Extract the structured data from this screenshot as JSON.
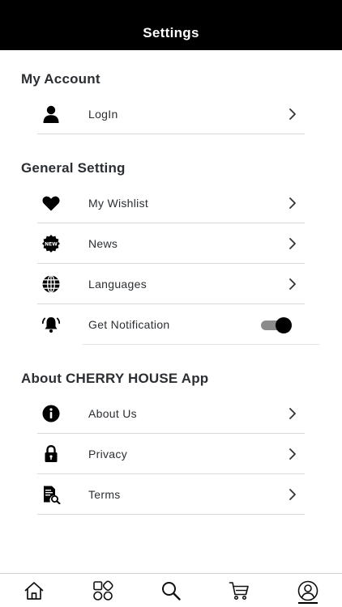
{
  "header": {
    "title": "Settings"
  },
  "sections": {
    "account": {
      "title": "My Account",
      "items": [
        {
          "label": "LogIn",
          "icon": "user-icon"
        }
      ]
    },
    "general": {
      "title": "General Setting",
      "items": [
        {
          "label": "My Wishlist",
          "icon": "heart-icon"
        },
        {
          "label": "News",
          "icon": "new-badge-icon"
        },
        {
          "label": "Languages",
          "icon": "globe-icon"
        },
        {
          "label": "Get Notification",
          "icon": "bell-icon",
          "toggle": true
        }
      ]
    },
    "about": {
      "title": "About CHERRY HOUSE App",
      "items": [
        {
          "label": "About Us",
          "icon": "info-icon"
        },
        {
          "label": "Privacy",
          "icon": "lock-icon"
        },
        {
          "label": "Terms",
          "icon": "document-search-icon"
        }
      ]
    }
  },
  "news_badge_text": "NEW",
  "tabbar": {
    "items": [
      "home-icon",
      "categories-icon",
      "search-icon",
      "cart-icon",
      "profile-icon"
    ],
    "active": "profile-icon"
  },
  "colors": {
    "header_bg": "#000000",
    "toggle_knob": "#000000",
    "toggle_track": "#8a8a8a"
  }
}
